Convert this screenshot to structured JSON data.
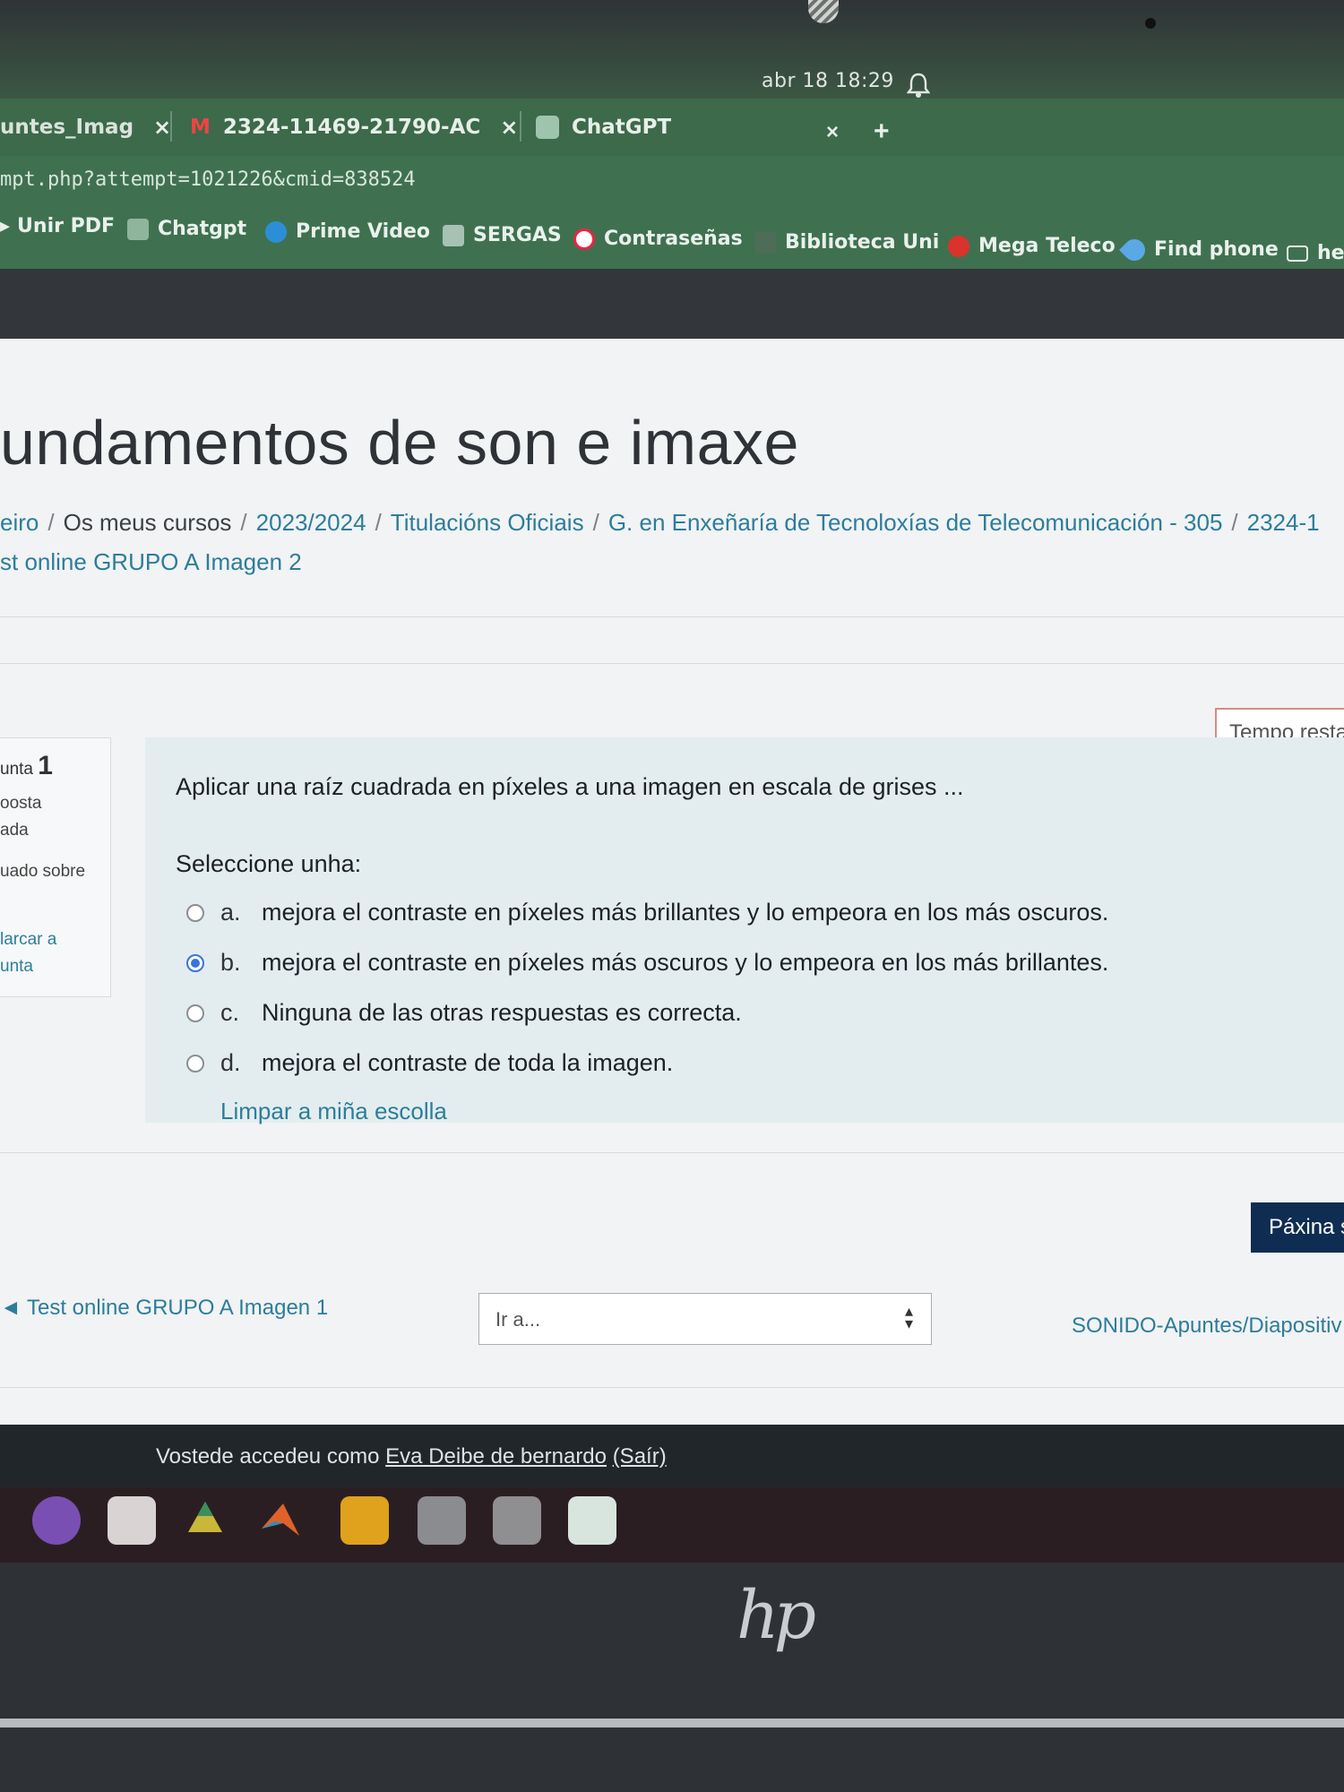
{
  "system": {
    "clock": "abr 18  18:29"
  },
  "tabs": [
    {
      "label": "untes_Imag",
      "icon": "document-icon"
    },
    {
      "label": "2324-11469-21790-AC",
      "icon": "gmail-icon"
    },
    {
      "label": "ChatGPT",
      "icon": "chatgpt-icon"
    }
  ],
  "url": "mpt.php?attempt=1021226&cmid=838524",
  "bookmarks": [
    {
      "label": "Unir PDF",
      "icon": "pdf-icon"
    },
    {
      "label": "Chatgpt",
      "icon": "chatgpt-icon"
    },
    {
      "label": "Prime Video",
      "icon": "play-icon"
    },
    {
      "label": "SERGAS",
      "icon": "sergas-icon"
    },
    {
      "label": "Contraseñas",
      "icon": "google-icon"
    },
    {
      "label": "Biblioteca Uni",
      "icon": "library-icon"
    },
    {
      "label": "Mega Teleco",
      "icon": "mega-icon"
    },
    {
      "label": "Find phone",
      "icon": "location-icon"
    },
    {
      "label": "he",
      "icon": "folder-icon"
    }
  ],
  "page": {
    "title": "undamentos de son e imaxe",
    "breadcrumb": [
      {
        "label": "eiro"
      },
      {
        "label": "Os meus cursos"
      },
      {
        "label": "2023/2024"
      },
      {
        "label": "Titulacións Oficiais"
      },
      {
        "label": "G. en Enxeñaría de Tecnoloxías de Telecomunicación - 305"
      },
      {
        "label": "2324-1"
      }
    ],
    "breadcrumb_line2": "st online GRUPO A Imagen 2",
    "timer_label": "Tempo resta"
  },
  "question_info": {
    "number_prefix": "unta",
    "number": "1",
    "status_line1": "oosta",
    "status_line2": "ada",
    "grade": "uado sobre",
    "flag_line1": "larcar a",
    "flag_line2": "unta"
  },
  "question": {
    "text": "Aplicar una raíz cuadrada en píxeles a una imagen en escala de grises ...",
    "prompt": "Seleccione unha:",
    "options": [
      {
        "letter": "a.",
        "text": "mejora el contraste en píxeles más brillantes y lo empeora en los más oscuros.",
        "checked": false
      },
      {
        "letter": "b.",
        "text": "mejora el contraste en píxeles más oscuros y lo empeora en los más brillantes.",
        "checked": true
      },
      {
        "letter": "c.",
        "text": "Ninguna de las otras respuestas es correcta.",
        "checked": false
      },
      {
        "letter": "d.",
        "text": "mejora el contraste de toda la imagen.",
        "checked": false
      }
    ],
    "clear_label": "Limpar a miña escolla"
  },
  "nav": {
    "next_page_label": "Páxina s",
    "prev_activity": "◄ Test online GRUPO A Imagen 1",
    "jump_placeholder": "Ir a...",
    "next_activity": "SONIDO-Apuntes/Diapositiv"
  },
  "footer": {
    "prefix": "Vostede accedeu como ",
    "user": "Eva Deibe de bernardo",
    "logout": "(Saír)"
  },
  "laptop_brand": "hp",
  "colors": {
    "link": "#2d7d9a",
    "question_bg": "#e3edf0",
    "primary_button": "#0f2d52",
    "radio_selected": "#3b73d9",
    "tabstrip": "#3c6a4a"
  }
}
